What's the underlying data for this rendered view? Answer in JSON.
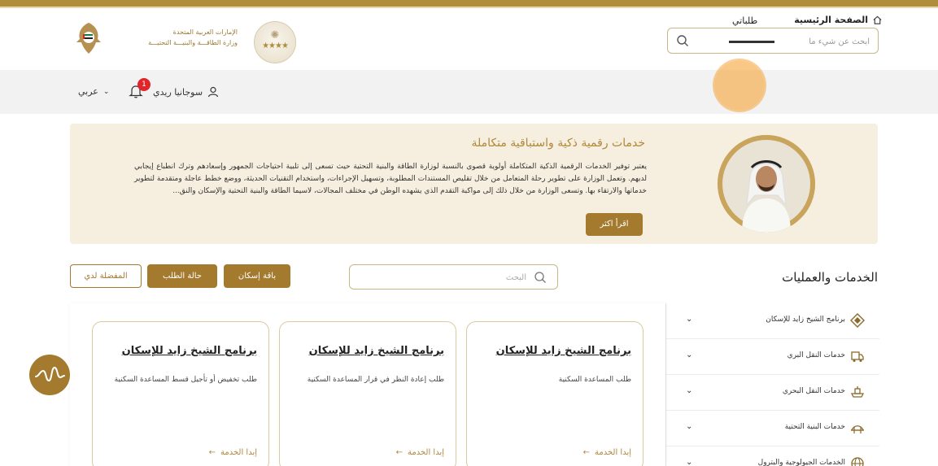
{
  "colors": {
    "gold": "#b08d3a",
    "button": "#a47a2f",
    "hero_bg": "#f6efdf",
    "nav_bg": "#f2f2f2",
    "badge": "#e0252b",
    "highlight": "#f6a63c"
  },
  "header": {
    "logo_line1": "الإمارات العربية المتحدة",
    "logo_line2": "وزارة الطاقـــة والبنيـــة التحتيـــة",
    "search_placeholder": "ابحث عن شيء ما"
  },
  "nav": {
    "home": "الصفحة الرئيسية",
    "requests": "طلباتي",
    "user_name": "سوجانيا ريدي",
    "notifications_count": "1",
    "language": "عربي",
    "icons": {
      "home": "home-icon",
      "user": "user-icon",
      "bell": "bell-icon",
      "lang": "chevron-down-icon"
    }
  },
  "hero": {
    "title": "خدمات رقمية ذكية واستباقية متكاملة",
    "text": "يعتبر توفير الخدمات الرقمية الذكية المتكاملة أولوية قصوى بالنسبة لوزارة الطاقة والبنية التحتية حيث تسعى إلى تلبية احتياجات الجمهور وإسعادهم وترك انطباع إيجابي لديهم. وتعمل الوزارة على تطوير رحلة المتعامل من خلال تقليص المستندات المطلوبة، وتسهيل الإجراءات، واستخدام التقنيات الحديثة، ووضع خطط عاجلة ومتقدمة لتطوير خدماتها والارتقاء بها. وتسعى الوزارة من خلال ذلك إلى مواكبة التقدم الذي يشهده الوطن في مختلف المجالات، لاسيما الطاقة والبنية التحتية والإسكان والنق...",
    "read_more": "اقرأ اكثر"
  },
  "services": {
    "title": "الخدمات والعمليات",
    "search_placeholder": "البحث",
    "buttons": {
      "package": "باقة إسكان",
      "status": "حالة الطلب",
      "favorites": "المفضلة لدي"
    },
    "sidebar": [
      {
        "label": "برنامج الشيخ زايد للإسكان",
        "icon": "housing-program-icon"
      },
      {
        "label": "خدمات النقل البري",
        "icon": "truck-icon"
      },
      {
        "label": "خدمات النقل البحري",
        "icon": "ship-icon"
      },
      {
        "label": "خدمات البنية التحتية",
        "icon": "bridge-icon"
      },
      {
        "label": "الخدمات الجيولوجية والبترول",
        "icon": "globe-icon"
      }
    ],
    "cards": [
      {
        "title": "برنامج الشيخ زايد للإسكان",
        "desc": "طلب المساعدة السكنية",
        "action": "إبدا الخدمة"
      },
      {
        "title": "برنامج الشيخ زايد للإسكان",
        "desc": "طلب إعادة النظر في قرار المساعدة السكنية",
        "action": "إبدا الخدمة"
      },
      {
        "title": "برنامج الشيخ زايد للإسكان",
        "desc": "طلب تخفيض أو تأجيل قسط المساعدة السكنية",
        "action": "إبدا الخدمة"
      }
    ]
  }
}
